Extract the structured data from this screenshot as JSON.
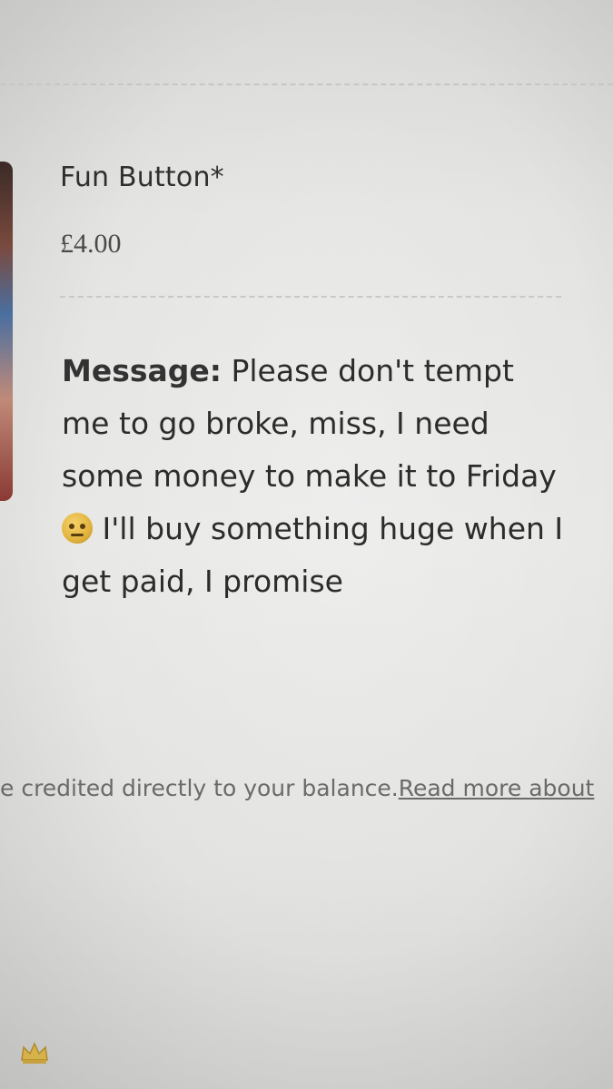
{
  "product": {
    "name": "Fun Button*",
    "price": "£4.00"
  },
  "message": {
    "label": "Message:",
    "text_before_emoji": "Please don't tempt me to go broke, miss, I need some money to make it to Friday",
    "emoji_icon": "neutral-face-icon",
    "text_after_emoji": "I'll buy something huge when I get paid, I promise"
  },
  "footer": {
    "note": "e credited directly to your balance.",
    "link": "Read more about"
  },
  "icons": {
    "thumbnail": "product-thumbnail",
    "corner": "crown-icon"
  },
  "colors": {
    "background": "#e6e6e4",
    "text": "#2c2c2c",
    "muted_text": "#6a6a6a",
    "emoji": "#e1b33d"
  }
}
